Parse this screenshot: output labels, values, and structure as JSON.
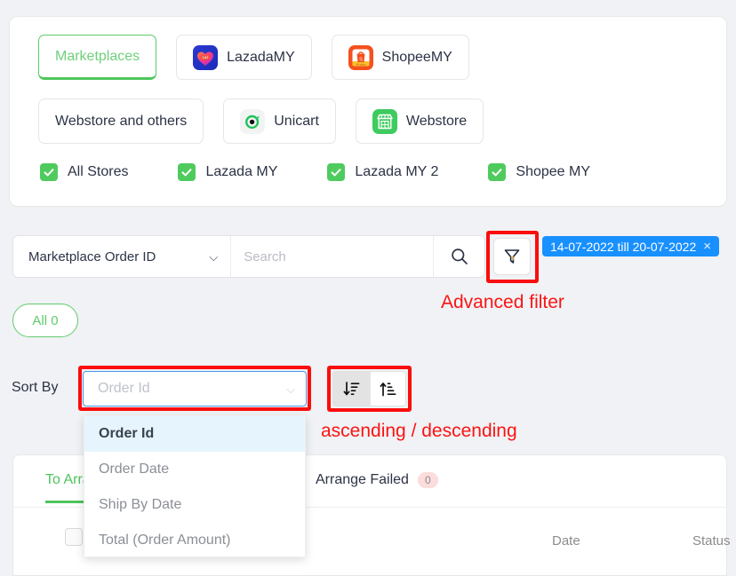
{
  "channel_card": {
    "chips_row1": [
      {
        "label": "Marketplaces",
        "icon": "",
        "active": true
      },
      {
        "label": "LazadaMY",
        "icon": "lazada-icon",
        "active": false
      },
      {
        "label": "ShopeeMY",
        "icon": "shopee-icon",
        "active": false
      }
    ],
    "chips_row2": [
      {
        "label": "Webstore and others",
        "icon": "",
        "active": false
      },
      {
        "label": "Unicart",
        "icon": "unicart-icon",
        "active": false
      },
      {
        "label": "Webstore",
        "icon": "webstore-icon",
        "active": false
      }
    ],
    "store_checkboxes": [
      {
        "label": "All Stores",
        "checked": true
      },
      {
        "label": "Lazada MY",
        "checked": true
      },
      {
        "label": "Lazada MY 2",
        "checked": true
      },
      {
        "label": "Shopee MY",
        "checked": true
      }
    ]
  },
  "search": {
    "type_selected": "Marketplace Order ID",
    "placeholder": "Search",
    "value": "",
    "search_icon": "search-icon",
    "filter_icon": "funnel-icon",
    "date_badge": "14-07-2022 till 20-07-2022",
    "date_badge_close": "×"
  },
  "annotations": {
    "advanced_filter": "Advanced filter",
    "ascending_descending": "ascending / descending",
    "color": "#fb1414"
  },
  "status_tag": {
    "label": "All 0"
  },
  "sort": {
    "label": "Sort By",
    "placeholder": "Order Id",
    "value": "",
    "chevron": "∨",
    "direction_buttons": [
      {
        "name": "descending",
        "active": true
      },
      {
        "name": "ascending",
        "active": false
      }
    ],
    "options": [
      {
        "label": "Order Id",
        "selected": true
      },
      {
        "label": "Order Date",
        "selected": false
      },
      {
        "label": "Ship By Date",
        "selected": false
      },
      {
        "label": "Total (Order Amount)",
        "selected": false
      }
    ]
  },
  "table": {
    "tabs": [
      {
        "label": "To Arrange",
        "badge": "",
        "active": true
      },
      {
        "label": "Arrange Failed",
        "badge": "0",
        "active": false
      }
    ],
    "columns": {
      "date": "Date",
      "status": "Status"
    }
  },
  "colors": {
    "brand_green": "#4ec45d",
    "badge_blue": "#1890ff",
    "annotation_red": "#fb1414",
    "page_bg": "#f0f2f5"
  }
}
